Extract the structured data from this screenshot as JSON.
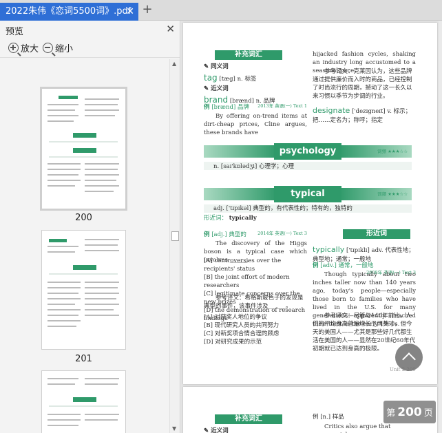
{
  "tab": {
    "title": "2022朱伟《恋词5500词》.pdf",
    "close": "✕",
    "new_tab": "+"
  },
  "sidebar": {
    "title": "预览",
    "close": "✕",
    "zoom_in": "放大",
    "zoom_out": "缩小",
    "thumbnails": [
      {
        "label": "200",
        "selected": true
      },
      {
        "label": "201",
        "selected": false
      },
      {
        "label": "202",
        "selected": false
      }
    ]
  },
  "page_badge": {
    "prefix": "第",
    "number": "200",
    "suffix": "页"
  },
  "document": {
    "supplement_header": "补充词汇",
    "synonyms_label": "同义词",
    "tag_word": "tag",
    "tag_rest": "[tæg] n. 标签",
    "near_synonyms_label": "近义词",
    "brand_word": "brand",
    "brand_rest": "[brænd] n. 品牌",
    "example_label": "例",
    "example_word_brand": "[brænd] 品牌",
    "example_source_brand": "2013年 英语(一) Text 1",
    "brand_text": "By offering on-trend items at dirt-cheap prices, Cline argues, these brands have",
    "right_text": "hijacked fashion cycles, shaking an industry long accustomed to a seasonal pace.",
    "ref_label": "参考译文：",
    "right_translation": "克莱因认为，这些品牌通过提供廉价而入时的商品，已经控制了时尚流行的周期，撼动了这一长久以来习惯以季节为步调的行业。",
    "designate_word": "designate",
    "designate_rest": "['dezɪgneɪt] v. 标示；把……定名为；称呼；指定",
    "psychology_word": "psychology",
    "psychology_freq": "词频 ★★★☆☆",
    "psychology_def": "n.   [saɪ'kɒlədʒi] 心理学；心理",
    "typical_word": "typical",
    "typical_freq": "词频 ★★★☆☆",
    "typical_def": "adj.   ['tɪpɪkəl] 典型的，有代表性的；特有的，独特的",
    "typical_near_label": "形近词：",
    "typical_near": "typically",
    "typical_example_head": "[adj.] 典型的",
    "typical_example_source": "2014年 英语(一) Text 3",
    "typical_example_text": "The discovery of the Higgs boson is a typical case which involves ______.",
    "options": [
      "[A] controversies over the recipients' status",
      "[B] the joint effort of modern researchers",
      "[C] legitimate concerns over the new prizes",
      "[D] the demonstration of research findings"
    ],
    "typical_translation": "希格斯玻色子的发现是典型的事件，该事件涉及______。",
    "options_cn": [
      "[A] 对获奖人地位的争议",
      "[B] 现代研究人员的共同努力",
      "[C] 对新奖项合情合理的顾虑",
      "[D] 对研究成果的示范"
    ],
    "form_header": "形近词",
    "typically_word": "typically",
    "typically_rest": "['tɪpɪkli] adv. 代表性地；典型地；通常；一般地",
    "typically_example_head": "[adv.] 通常，一般地",
    "typically_example_source": "2008年 英语(一) Text 3",
    "typically_text": "Though typically about two inches taller now than 140 years ago, today's people—especially those born to families who have lived in the U.S. for many generations—apparently reached their limit in the early 1960s.",
    "typically_translation": "尽管与140年前比，人们的平均身高普遍增长了两英寸，但今天的美国人——尤其是那些好几代都生活在美国的人——显然在20世纪60年代初期就已达到身高的极限。",
    "page_footer": "Unit 2 200",
    "p2_header": "补充词汇",
    "p2_synonym": "近义词",
    "p2_example": "例 [n.] 样品",
    "p2_text": "Critics also argue that commercial"
  },
  "colors": {
    "tab_blue": "#2f6fd6",
    "brand_green": "#2f9a6a"
  }
}
